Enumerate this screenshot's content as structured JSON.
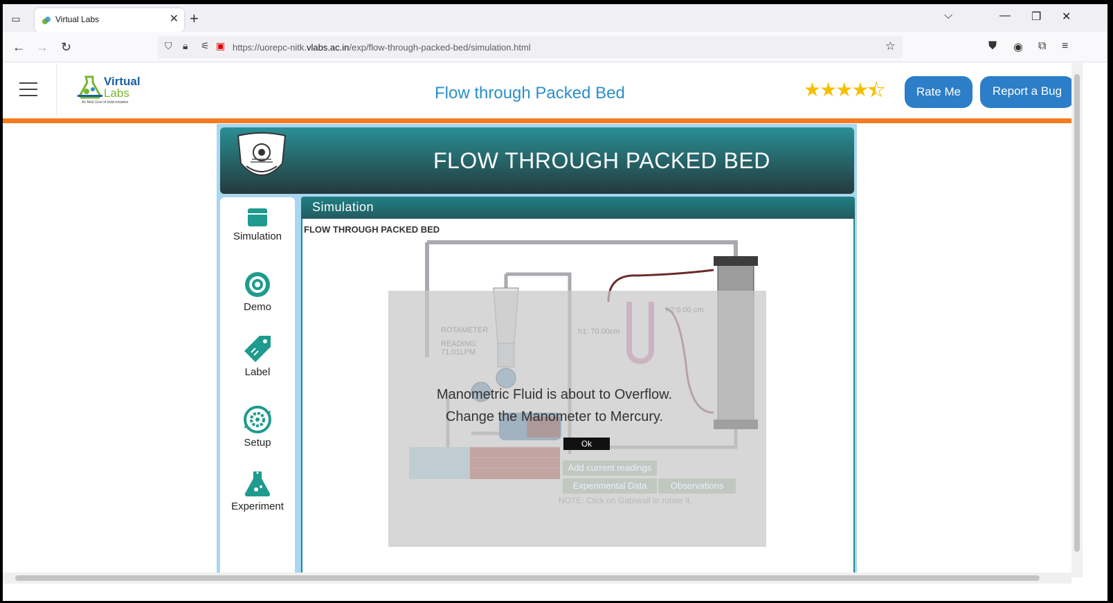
{
  "browser": {
    "tab_title": "Virtual Labs",
    "url_prefix": "https://uorepc-nitk.",
    "url_domain": "vlabs.ac.in",
    "url_path": "/exp/flow-through-packed-bed/simulation.html"
  },
  "header": {
    "logo_line1": "Virtual",
    "logo_line2": "Labs",
    "logo_sub": "An MoE Govt of India Initiative",
    "title": "Flow through Packed Bed",
    "rating": 4.5,
    "rating_color": "#f5c000",
    "rate_label": "Rate Me",
    "bug_label": "Report a Bug",
    "accent": "#2b7ec7",
    "stripe": "#f47b20"
  },
  "banner": {
    "title": "FLOW THROUGH PACKED BED"
  },
  "sidebar": {
    "items": [
      {
        "label": "Simulation",
        "icon": "window-icon"
      },
      {
        "label": "Demo",
        "icon": "target-icon"
      },
      {
        "label": "Label",
        "icon": "tag-icon"
      },
      {
        "label": "Setup",
        "icon": "gear-icon"
      },
      {
        "label": "Experiment",
        "icon": "flask-icon"
      }
    ]
  },
  "main": {
    "header": "Simulation",
    "sim_title": "FLOW THROUGH PACKED BED",
    "rotameter_label": "ROTAMETER",
    "reading_label": "READING:",
    "reading_value": "71.01LPM",
    "h1_label": "h1: 70.00cm",
    "h2_label": "h2:0.00   cm",
    "alert_line1": "Manometric Fluid is about to Overflow.",
    "alert_line2": "Change the Manometer to Mercury.",
    "ok_label": "Ok",
    "add_readings": "Add current readings",
    "exp_data": "Experimental Data",
    "observations": "Observations",
    "note": "NOTE: Click on Gatewall to rotate it."
  }
}
